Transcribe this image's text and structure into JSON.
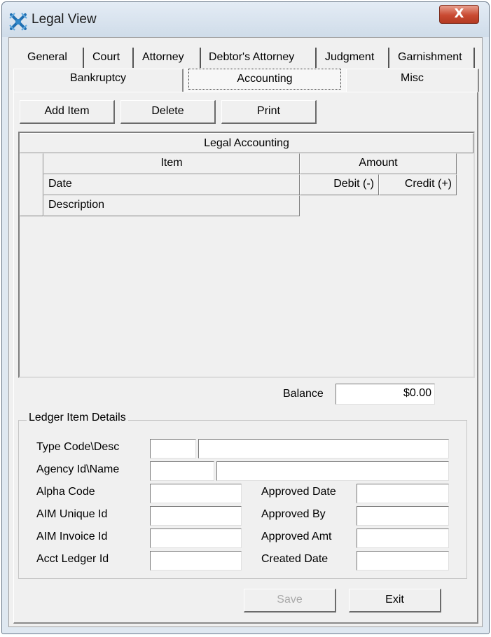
{
  "window": {
    "title": "Legal View",
    "close_label": "X"
  },
  "tabs": {
    "row1": [
      "General",
      "Court",
      "Attorney",
      "Debtor's Attorney",
      "Judgment",
      "Garnishment"
    ],
    "row2": [
      "Bankruptcy",
      "Accounting",
      "Misc"
    ],
    "active": "Accounting"
  },
  "toolbar": {
    "add_item": "Add Item",
    "delete": "Delete",
    "print": "Print"
  },
  "grid": {
    "title": "Legal Accounting",
    "col_item": "Item",
    "col_amount": "Amount",
    "col_date": "Date",
    "col_debit": "Debit (-)",
    "col_credit": "Credit (+)",
    "col_description": "Description",
    "rows": []
  },
  "balance": {
    "label": "Balance",
    "value": "$0.00"
  },
  "ledger": {
    "group_title": "Ledger Item Details",
    "type_code_label": "Type Code\\Desc",
    "agency_label": "Agency Id\\Name",
    "alpha_code_label": "Alpha Code",
    "aim_unique_label": "AIM Unique Id",
    "aim_invoice_label": "AIM Invoice Id",
    "acct_ledger_label": "Acct Ledger Id",
    "approved_date_label": "Approved Date",
    "approved_by_label": "Approved By",
    "approved_amt_label": "Approved Amt",
    "created_date_label": "Created Date"
  },
  "footer": {
    "save": "Save",
    "exit": "Exit"
  },
  "colors": {
    "close_button": "#c94a32",
    "titlebar": "#dfe8f1",
    "dialog_bg": "#f0f0f0"
  },
  "icons": {
    "app": "legal-view-app-icon"
  }
}
